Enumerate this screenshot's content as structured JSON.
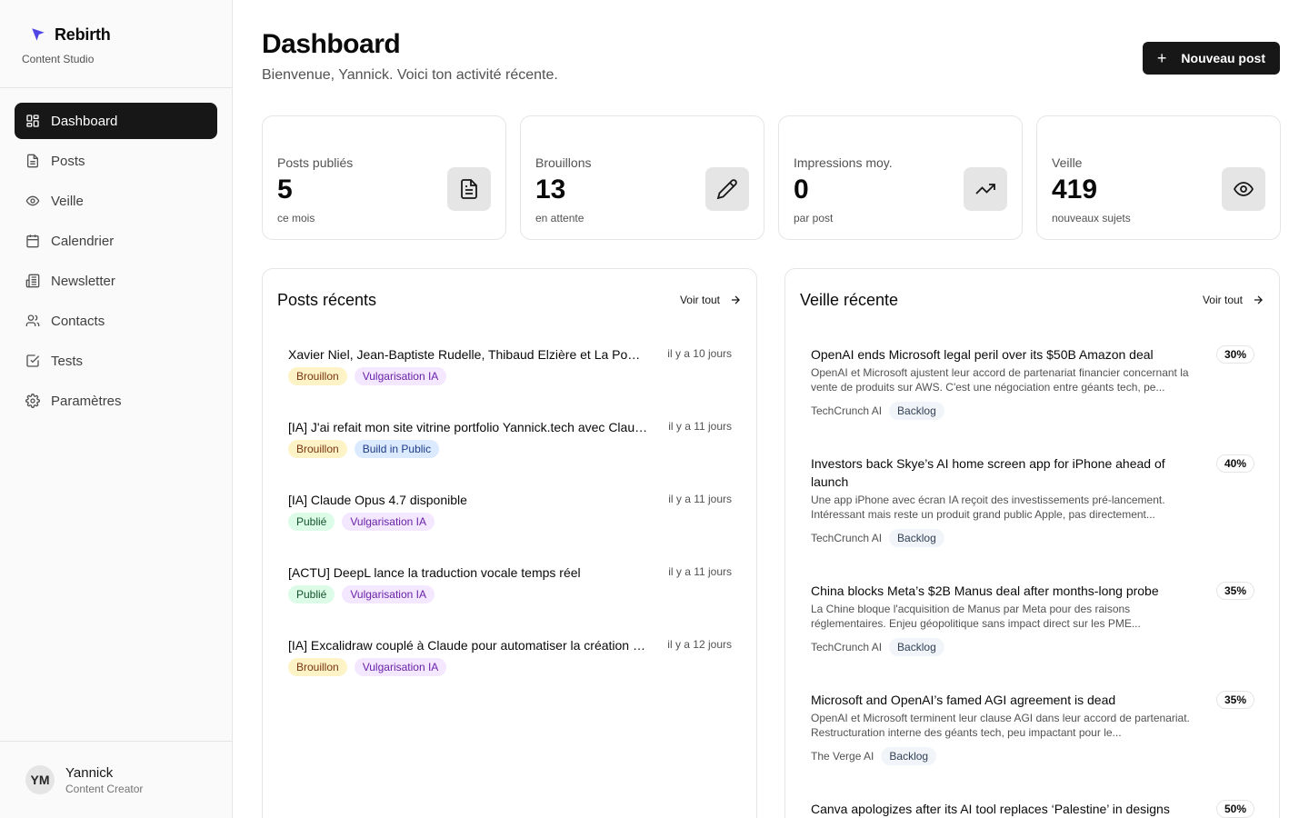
{
  "brand": {
    "name": "Rebirth",
    "subtitle": "Content Studio",
    "accent": "#4f46e5"
  },
  "nav": [
    {
      "label": "Dashboard",
      "icon": "grid-icon",
      "active": true
    },
    {
      "label": "Posts",
      "icon": "document-icon"
    },
    {
      "label": "Veille",
      "icon": "eye-icon"
    },
    {
      "label": "Calendrier",
      "icon": "calendar-icon"
    },
    {
      "label": "Newsletter",
      "icon": "newspaper-icon"
    },
    {
      "label": "Contacts",
      "icon": "users-icon"
    },
    {
      "label": "Tests",
      "icon": "checkbox-icon"
    },
    {
      "label": "Paramètres",
      "icon": "gear-icon"
    }
  ],
  "user": {
    "initials": "YM",
    "name": "Yannick",
    "role": "Content Creator"
  },
  "header": {
    "title": "Dashboard",
    "subtitle": "Bienvenue, Yannick. Voici ton activité récente.",
    "new_post_label": "Nouveau post"
  },
  "stats": [
    {
      "label": "Posts publiés",
      "value": "5",
      "hint": "ce mois",
      "icon": "file-text-icon"
    },
    {
      "label": "Brouillons",
      "value": "13",
      "hint": "en attente",
      "icon": "pencil-icon"
    },
    {
      "label": "Impressions moy.",
      "value": "0",
      "hint": "par post",
      "icon": "trending-up-icon"
    },
    {
      "label": "Veille",
      "value": "419",
      "hint": "nouveaux sujets",
      "icon": "eye-icon"
    }
  ],
  "recent_posts": {
    "title": "Posts récents",
    "see_all": "Voir tout",
    "items": [
      {
        "title": "Xavier Niel, Jean-Baptiste Rudelle, Thibaud Elzière et La Poste investissent dans l'IA",
        "time": "il y a 10 jours",
        "status": "Brouillon",
        "category": "Vulgarisation IA"
      },
      {
        "title": "[IA] J'ai refait mon site vitrine portfolio Yannick.tech avec Claude Code",
        "time": "il y a 11 jours",
        "status": "Brouillon",
        "category": "Build in Public"
      },
      {
        "title": "[IA] Claude Opus 4.7 disponible",
        "time": "il y a 11 jours",
        "status": "Publié",
        "category": "Vulgarisation IA"
      },
      {
        "title": "[ACTU] DeepL lance la traduction vocale temps réel",
        "time": "il y a 11 jours",
        "status": "Publié",
        "category": "Vulgarisation IA"
      },
      {
        "title": "[IA] Excalidraw couplé à Claude pour automatiser la création de schémas",
        "time": "il y a 12 jours",
        "status": "Brouillon",
        "category": "Vulgarisation IA"
      }
    ]
  },
  "recent_watch": {
    "title": "Veille récente",
    "see_all": "Voir tout",
    "items": [
      {
        "title": "OpenAI ends Microsoft legal peril over its $50B Amazon deal",
        "score": "30%",
        "desc": "OpenAI et Microsoft ajustent leur accord de partenariat financier concernant la vente de produits sur AWS. C'est une négociation entre géants tech, pe...",
        "source": "TechCrunch AI",
        "status": "Backlog"
      },
      {
        "title": "Investors back Skye’s AI home screen app for iPhone ahead of launch",
        "score": "40%",
        "desc": "Une app iPhone avec écran IA reçoit des investissements pré-lancement. Intéressant mais reste un produit grand public Apple, pas directement...",
        "source": "TechCrunch AI",
        "status": "Backlog"
      },
      {
        "title": "China blocks Meta’s $2B Manus deal after months-long probe",
        "score": "35%",
        "desc": "La Chine bloque l'acquisition de Manus par Meta pour des raisons réglementaires. Enjeu géopolitique sans impact direct sur les PME...",
        "source": "TechCrunch AI",
        "status": "Backlog"
      },
      {
        "title": "Microsoft and OpenAI’s famed AGI agreement is dead",
        "score": "35%",
        "desc": "OpenAI et Microsoft terminent leur clause AGI dans leur accord de partenariat. Restructuration interne des géants tech, peu impactant pour le...",
        "source": "The Verge AI",
        "status": "Backlog"
      },
      {
        "title": "Canva apologizes after its AI tool replaces ‘Palestine’ in designs",
        "score": "50%",
        "desc": "",
        "source": "",
        "status": ""
      }
    ]
  }
}
